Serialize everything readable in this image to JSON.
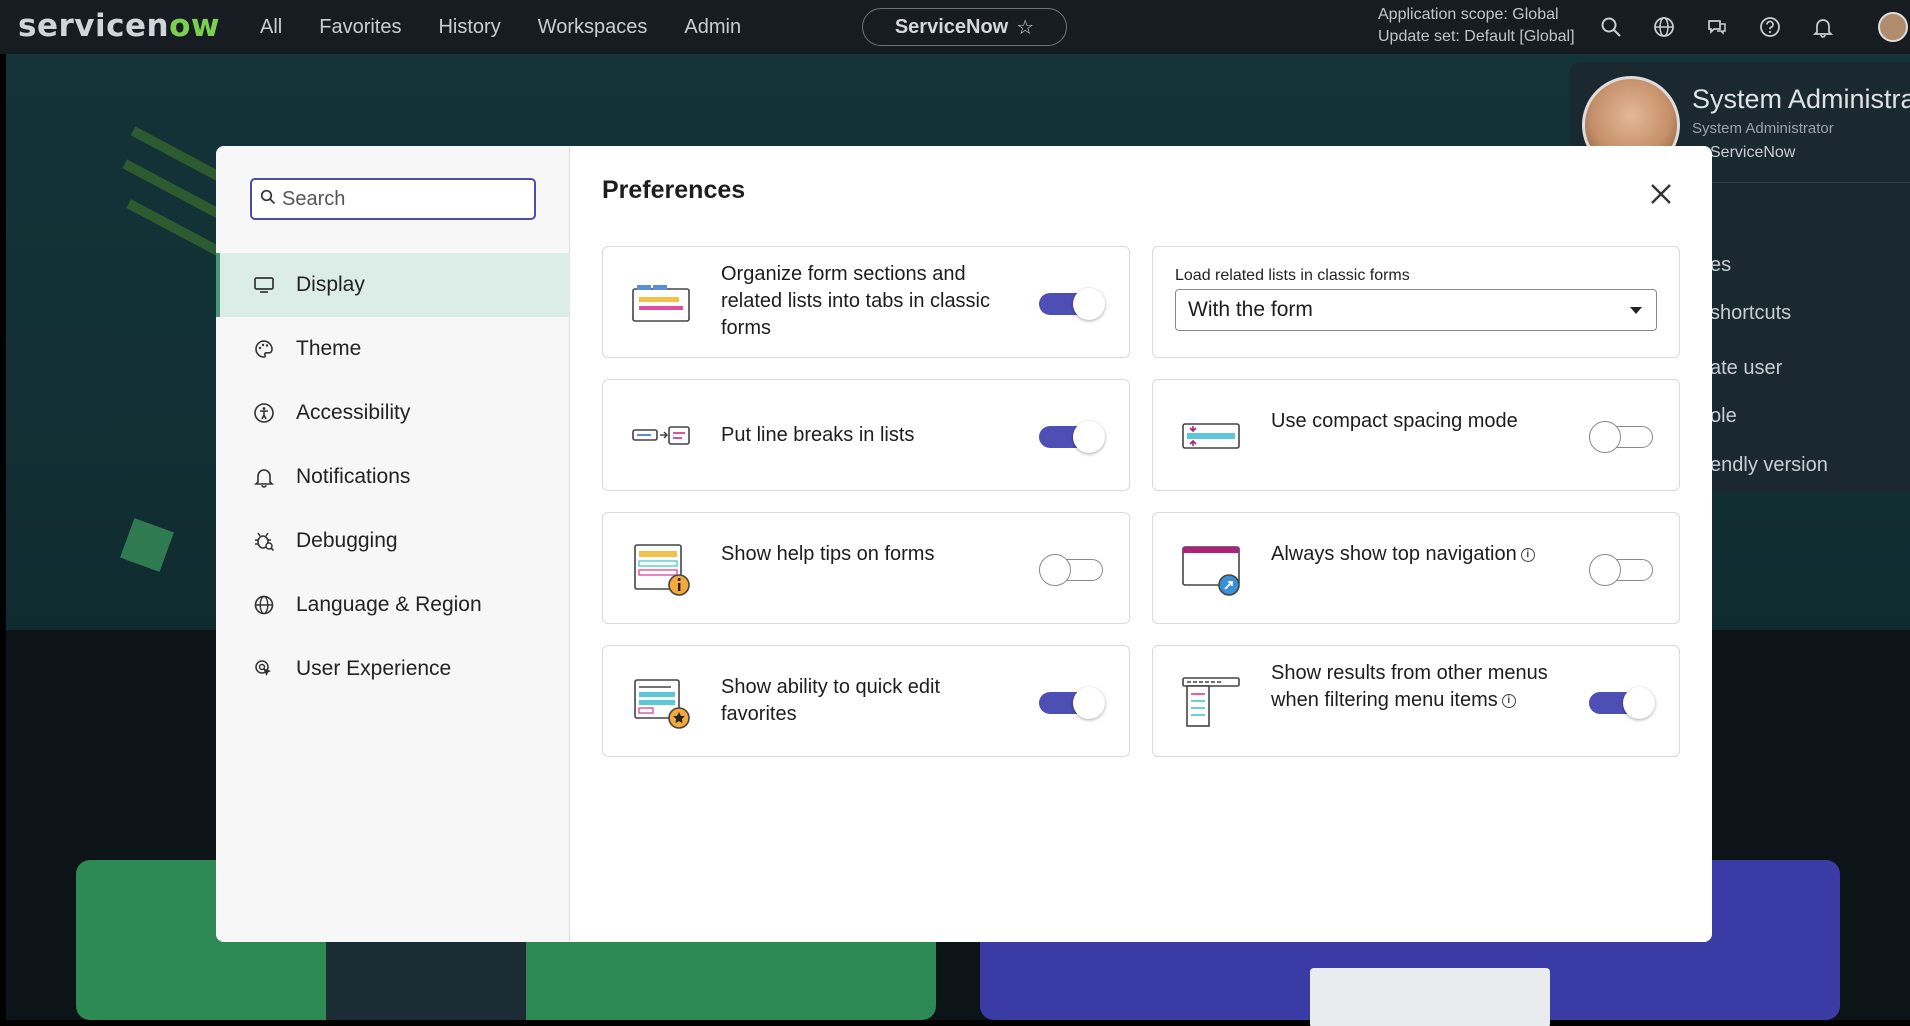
{
  "topnav": {
    "logo_pre": "servicen",
    "logo_ow": "ow",
    "links": [
      "All",
      "Favorites",
      "History",
      "Workspaces",
      "Admin"
    ],
    "pill_label": "ServiceNow",
    "pill_star": "☆",
    "scope_line1": "Application scope: Global",
    "scope_line2": "Update set: Default [Global]",
    "icons": [
      "search-icon",
      "globe-icon",
      "chat-icon",
      "help-icon",
      "bell-icon",
      "avatar"
    ]
  },
  "user_panel": {
    "name": "System Administra",
    "role": "System Administrator",
    "company": "ServiceNow",
    "items": [
      "es",
      "shortcuts",
      "ate user",
      "ole",
      "endly version"
    ]
  },
  "modal": {
    "title": "Preferences",
    "search_placeholder": "Search",
    "nav": [
      {
        "label": "Display",
        "icon": "monitor-icon",
        "active": true
      },
      {
        "label": "Theme",
        "icon": "palette-icon",
        "active": false
      },
      {
        "label": "Accessibility",
        "icon": "accessibility-icon",
        "active": false
      },
      {
        "label": "Notifications",
        "icon": "bell-icon",
        "active": false
      },
      {
        "label": "Debugging",
        "icon": "bug-icon",
        "active": false
      },
      {
        "label": "Language & Region",
        "icon": "globe-icon",
        "active": false
      },
      {
        "label": "User Experience",
        "icon": "cursor-icon",
        "active": false
      }
    ],
    "settings": {
      "tabs": {
        "label": "Organize form sections and related lists into tabs in classic forms",
        "enabled": true
      },
      "related_lists": {
        "label": "Load related lists in classic forms",
        "value": "With the form"
      },
      "line_breaks": {
        "label": "Put line breaks in lists",
        "enabled": true
      },
      "compact": {
        "label": "Use compact spacing mode",
        "enabled": false
      },
      "help_tips": {
        "label": "Show help tips on forms",
        "enabled": false
      },
      "top_nav": {
        "label": "Always show top navigation",
        "info": "i",
        "enabled": false
      },
      "quick_edit": {
        "label": "Show ability to quick edit favorites",
        "enabled": true
      },
      "menu_results": {
        "label": "Show results from other menus when filtering menu items",
        "info": "i",
        "enabled": true
      }
    }
  },
  "colors": {
    "accent": "#4d4fb5",
    "active_nav": "#dcede7",
    "active_bar": "#4c9a74",
    "nav_bg": "#171c22"
  }
}
